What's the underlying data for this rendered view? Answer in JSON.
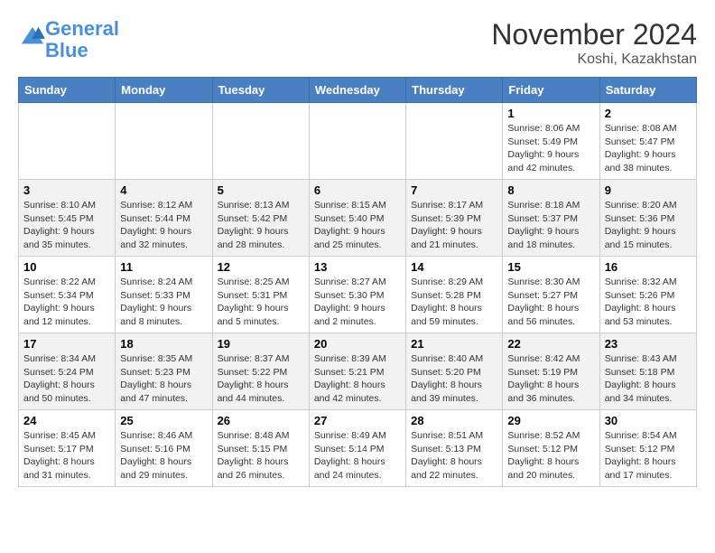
{
  "header": {
    "logo_line1": "General",
    "logo_line2": "Blue",
    "month": "November 2024",
    "location": "Koshi, Kazakhstan"
  },
  "weekdays": [
    "Sunday",
    "Monday",
    "Tuesday",
    "Wednesday",
    "Thursday",
    "Friday",
    "Saturday"
  ],
  "weeks": [
    [
      {
        "day": "",
        "info": ""
      },
      {
        "day": "",
        "info": ""
      },
      {
        "day": "",
        "info": ""
      },
      {
        "day": "",
        "info": ""
      },
      {
        "day": "",
        "info": ""
      },
      {
        "day": "1",
        "info": "Sunrise: 8:06 AM\nSunset: 5:49 PM\nDaylight: 9 hours and 42 minutes."
      },
      {
        "day": "2",
        "info": "Sunrise: 8:08 AM\nSunset: 5:47 PM\nDaylight: 9 hours and 38 minutes."
      }
    ],
    [
      {
        "day": "3",
        "info": "Sunrise: 8:10 AM\nSunset: 5:45 PM\nDaylight: 9 hours and 35 minutes."
      },
      {
        "day": "4",
        "info": "Sunrise: 8:12 AM\nSunset: 5:44 PM\nDaylight: 9 hours and 32 minutes."
      },
      {
        "day": "5",
        "info": "Sunrise: 8:13 AM\nSunset: 5:42 PM\nDaylight: 9 hours and 28 minutes."
      },
      {
        "day": "6",
        "info": "Sunrise: 8:15 AM\nSunset: 5:40 PM\nDaylight: 9 hours and 25 minutes."
      },
      {
        "day": "7",
        "info": "Sunrise: 8:17 AM\nSunset: 5:39 PM\nDaylight: 9 hours and 21 minutes."
      },
      {
        "day": "8",
        "info": "Sunrise: 8:18 AM\nSunset: 5:37 PM\nDaylight: 9 hours and 18 minutes."
      },
      {
        "day": "9",
        "info": "Sunrise: 8:20 AM\nSunset: 5:36 PM\nDaylight: 9 hours and 15 minutes."
      }
    ],
    [
      {
        "day": "10",
        "info": "Sunrise: 8:22 AM\nSunset: 5:34 PM\nDaylight: 9 hours and 12 minutes."
      },
      {
        "day": "11",
        "info": "Sunrise: 8:24 AM\nSunset: 5:33 PM\nDaylight: 9 hours and 8 minutes."
      },
      {
        "day": "12",
        "info": "Sunrise: 8:25 AM\nSunset: 5:31 PM\nDaylight: 9 hours and 5 minutes."
      },
      {
        "day": "13",
        "info": "Sunrise: 8:27 AM\nSunset: 5:30 PM\nDaylight: 9 hours and 2 minutes."
      },
      {
        "day": "14",
        "info": "Sunrise: 8:29 AM\nSunset: 5:28 PM\nDaylight: 8 hours and 59 minutes."
      },
      {
        "day": "15",
        "info": "Sunrise: 8:30 AM\nSunset: 5:27 PM\nDaylight: 8 hours and 56 minutes."
      },
      {
        "day": "16",
        "info": "Sunrise: 8:32 AM\nSunset: 5:26 PM\nDaylight: 8 hours and 53 minutes."
      }
    ],
    [
      {
        "day": "17",
        "info": "Sunrise: 8:34 AM\nSunset: 5:24 PM\nDaylight: 8 hours and 50 minutes."
      },
      {
        "day": "18",
        "info": "Sunrise: 8:35 AM\nSunset: 5:23 PM\nDaylight: 8 hours and 47 minutes."
      },
      {
        "day": "19",
        "info": "Sunrise: 8:37 AM\nSunset: 5:22 PM\nDaylight: 8 hours and 44 minutes."
      },
      {
        "day": "20",
        "info": "Sunrise: 8:39 AM\nSunset: 5:21 PM\nDaylight: 8 hours and 42 minutes."
      },
      {
        "day": "21",
        "info": "Sunrise: 8:40 AM\nSunset: 5:20 PM\nDaylight: 8 hours and 39 minutes."
      },
      {
        "day": "22",
        "info": "Sunrise: 8:42 AM\nSunset: 5:19 PM\nDaylight: 8 hours and 36 minutes."
      },
      {
        "day": "23",
        "info": "Sunrise: 8:43 AM\nSunset: 5:18 PM\nDaylight: 8 hours and 34 minutes."
      }
    ],
    [
      {
        "day": "24",
        "info": "Sunrise: 8:45 AM\nSunset: 5:17 PM\nDaylight: 8 hours and 31 minutes."
      },
      {
        "day": "25",
        "info": "Sunrise: 8:46 AM\nSunset: 5:16 PM\nDaylight: 8 hours and 29 minutes."
      },
      {
        "day": "26",
        "info": "Sunrise: 8:48 AM\nSunset: 5:15 PM\nDaylight: 8 hours and 26 minutes."
      },
      {
        "day": "27",
        "info": "Sunrise: 8:49 AM\nSunset: 5:14 PM\nDaylight: 8 hours and 24 minutes."
      },
      {
        "day": "28",
        "info": "Sunrise: 8:51 AM\nSunset: 5:13 PM\nDaylight: 8 hours and 22 minutes."
      },
      {
        "day": "29",
        "info": "Sunrise: 8:52 AM\nSunset: 5:12 PM\nDaylight: 8 hours and 20 minutes."
      },
      {
        "day": "30",
        "info": "Sunrise: 8:54 AM\nSunset: 5:12 PM\nDaylight: 8 hours and 17 minutes."
      }
    ]
  ]
}
